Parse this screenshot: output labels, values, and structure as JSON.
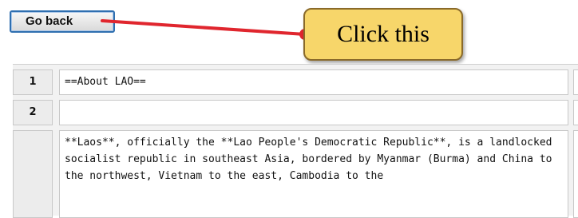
{
  "toolbar": {
    "go_back_label": "Go back"
  },
  "callout": {
    "text": "Click this"
  },
  "colors": {
    "arrow": "#e0262e",
    "callout_bg": "#f7d66a",
    "button_border": "#2f6fb0"
  },
  "rows": [
    {
      "num": "1",
      "text": "==About LAO=="
    },
    {
      "num": "2",
      "text": ""
    },
    {
      "num": "",
      "text": "**Laos**, officially the **Lao People's Democratic Republic**, is a landlocked socialist republic in southeast Asia, bordered by Myanmar (Burma) and China to the northwest, Vietnam to the east, Cambodia to the"
    }
  ]
}
